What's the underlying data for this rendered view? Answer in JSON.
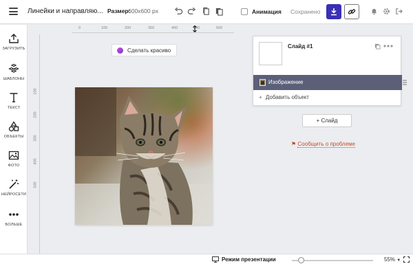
{
  "header": {
    "title": "Линейки и направляю...",
    "size_label": "Размер:",
    "size_value": "600x600 px",
    "animation_label": "Анимация",
    "animation_checked": false,
    "saved_status": "Сохранено"
  },
  "sidebar": {
    "items": [
      {
        "label": "ЗАГРУЗИТЬ",
        "icon": "upload-icon"
      },
      {
        "label": "ШАБЛОНЫ",
        "icon": "templates-icon"
      },
      {
        "label": "ТЕКСТ",
        "icon": "text-icon"
      },
      {
        "label": "ОБЪЕКТЫ",
        "icon": "shapes-icon"
      },
      {
        "label": "ФОТО",
        "icon": "photo-icon"
      },
      {
        "label": "НЕЙРОСЕТИ",
        "icon": "magic-wand-icon"
      },
      {
        "label": "БОЛЬШЕ",
        "icon": "more-icon"
      }
    ]
  },
  "rulers": {
    "top": [
      "0",
      "100",
      "200",
      "300",
      "400",
      "500",
      "600"
    ],
    "left": [
      "100",
      "200",
      "300",
      "400",
      "500"
    ]
  },
  "canvas": {
    "make_pretty_label": "Сделать красиво"
  },
  "slides_panel": {
    "slide_title": "Слайд #1",
    "layer_label": "Изображение",
    "add_object_label": "Добавить объект",
    "add_slide_label": "Слайд",
    "report_label": "Сообщить о проблеме"
  },
  "footer": {
    "presentation_label": "Режим презентации",
    "zoom_percent": 55,
    "zoom_label": "55%"
  },
  "colors": {
    "accent": "#3b2fb5",
    "layer_row": "#5b6078",
    "report": "#c24b2b"
  }
}
